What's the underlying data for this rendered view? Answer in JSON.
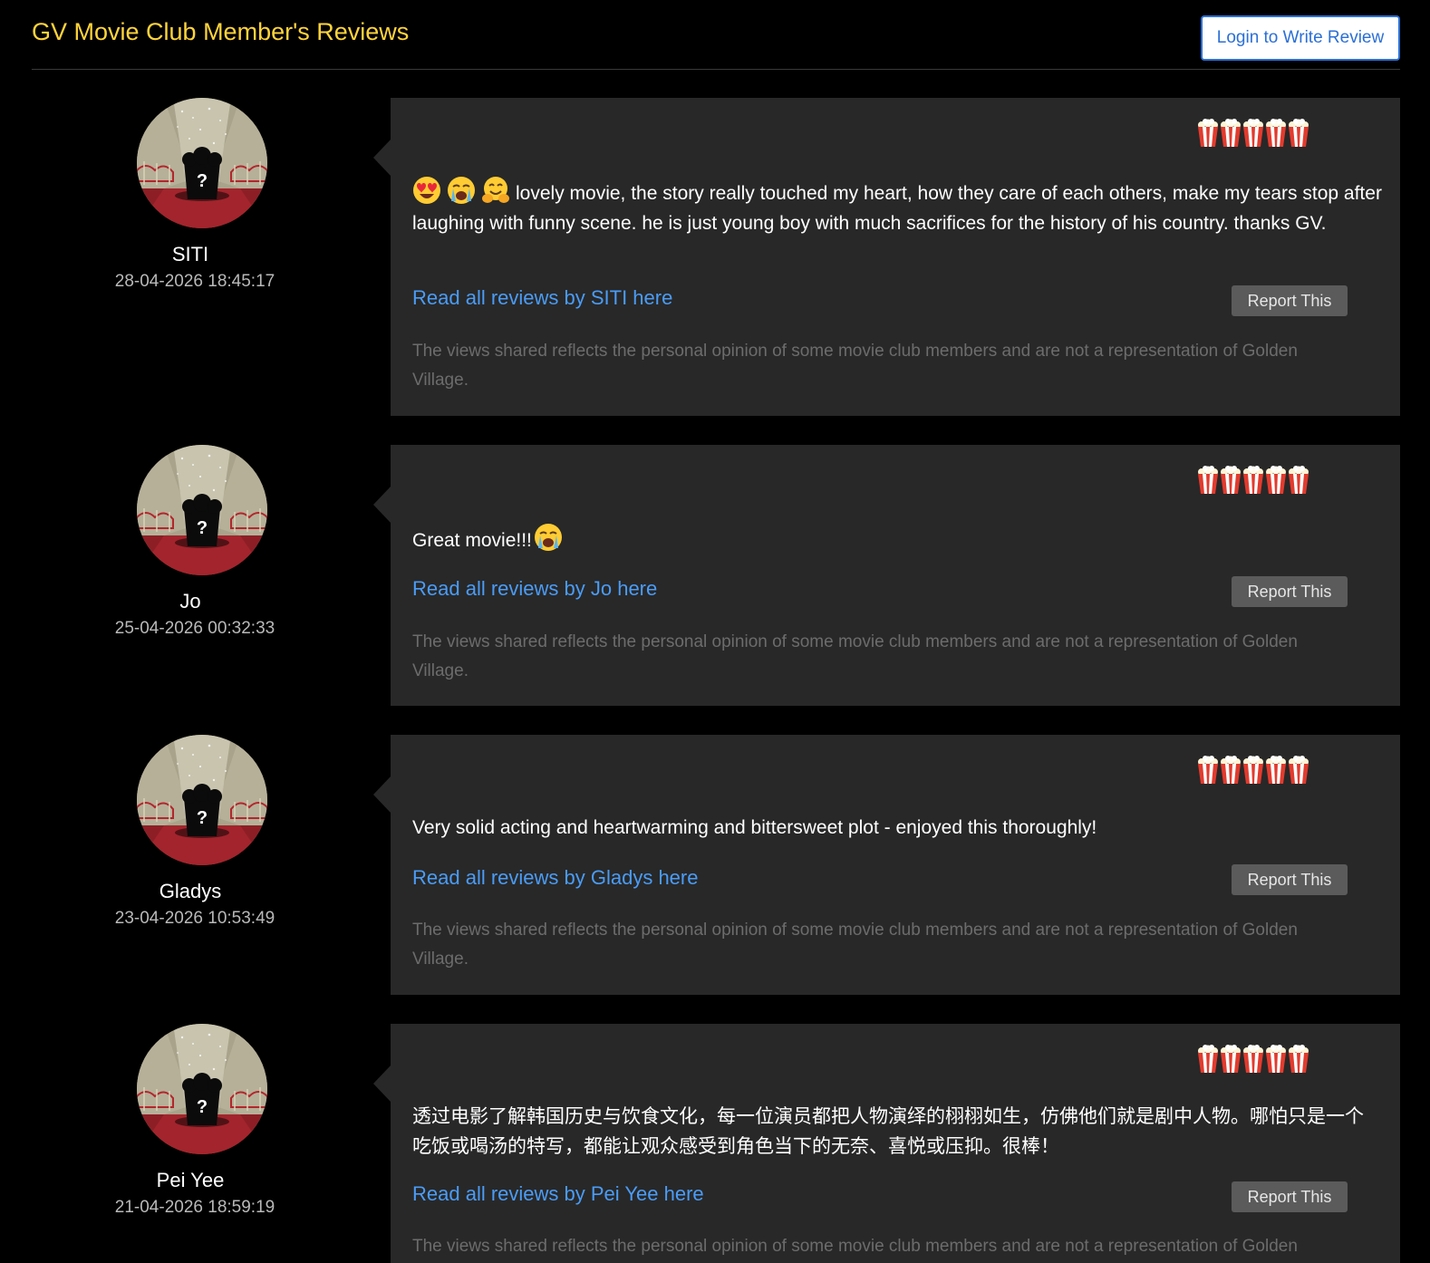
{
  "header": {
    "title": "GV Movie Club Member's Reviews",
    "login_button": "Login to Write Review"
  },
  "colors": {
    "background": "#000000",
    "title": "#ffd43b",
    "card": "#282828",
    "link": "#4a9cf7",
    "report_button": "#5b5b5b"
  },
  "rating_icon": "popcorn-icon",
  "reviews": [
    {
      "author": "SITI",
      "date": "28-04-2026 18:45:17",
      "rating": 5,
      "emojis": [
        "heart-eyes-emoji",
        "crying-emoji",
        "hugging-emoji"
      ],
      "text": "lovely movie, the story really touched my heart, how they care of each others, make my tears stop after laughing with funny scene. he is just young boy with much sacrifices for the history of his country. thanks GV.",
      "read_all": "Read all reviews by SITI here",
      "report": "Report This",
      "disclaimer": "The views shared reflects the personal opinion of some movie club members and are not a representation of Golden Village."
    },
    {
      "author": "Jo",
      "date": "25-04-2026 00:32:33",
      "rating": 5,
      "text": "Great movie!!!",
      "trailing_emoji": "crying-emoji",
      "read_all": "Read all reviews by Jo here",
      "report": "Report This",
      "disclaimer": "The views shared reflects the personal opinion of some movie club members and are not a representation of Golden Village."
    },
    {
      "author": "Gladys",
      "date": "23-04-2026 10:53:49",
      "rating": 5,
      "text": "Very solid acting and heartwarming and bittersweet plot - enjoyed this thoroughly!",
      "read_all": "Read all reviews by Gladys here",
      "report": "Report This",
      "disclaimer": "The views shared reflects the personal opinion of some movie club members and are not a representation of Golden Village."
    },
    {
      "author": "Pei Yee",
      "date": "21-04-2026 18:59:19",
      "rating": 5,
      "text": "透过电影了解韩国历史与饮食文化，每一位演员都把人物演绎的栩栩如生，仿佛他们就是剧中人物。哪怕只是一个吃饭或喝汤的特写，都能让观众感受到角色当下的无奈、喜悦或压抑。很棒！",
      "read_all": "Read all reviews by Pei Yee here",
      "report": "Report This",
      "disclaimer": "The views shared reflects the personal opinion of some movie club members and are not a representation of Golden Village."
    }
  ]
}
